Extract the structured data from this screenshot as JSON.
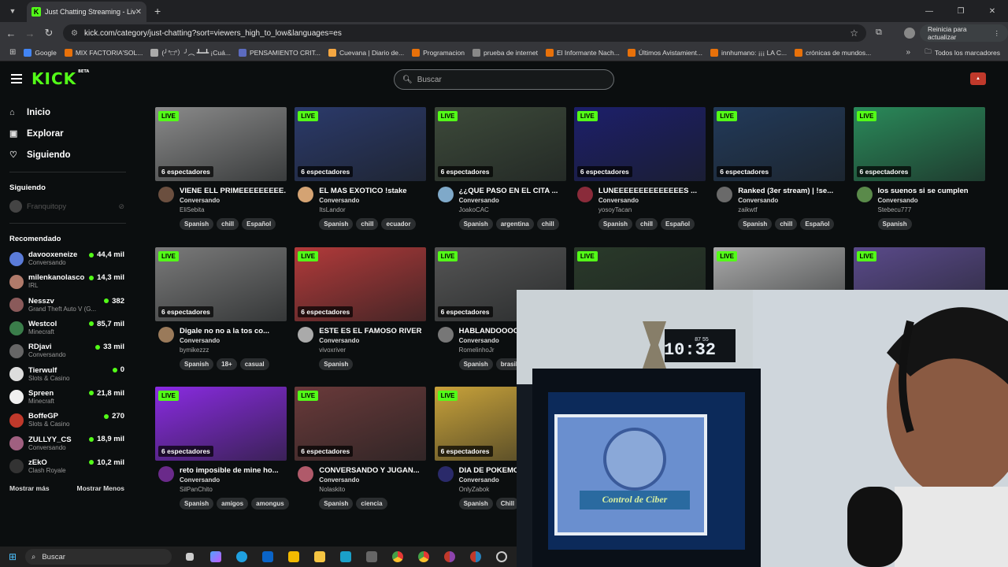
{
  "browser": {
    "tab_title": "Just Chatting Streaming - Live S",
    "url": "kick.com/category/just-chatting?sort=viewers_high_to_low&languages=es",
    "update_button": "Reinicia para actualizar",
    "bookmarks": [
      "Google",
      "MIX FACTORIA'SOL...",
      "(╯°□°）╯︵ ┻━┻ ¡Cuá...",
      "PENSAMIENTO CRIT...",
      "Cuevana | Diario de...",
      "Programacion",
      "prueba de internet",
      "El Informante Nach...",
      "Últimos Avistamient...",
      "innhumano: ¡¡¡ LA C...",
      "crónicas de mundos..."
    ],
    "all_bookmarks": "Todos los marcadores"
  },
  "header": {
    "logo": "KICK",
    "logo_badge": "BETA",
    "search_placeholder": "Buscar"
  },
  "sidebar": {
    "nav": [
      {
        "label": "Inicio",
        "icon": "home-icon"
      },
      {
        "label": "Explorar",
        "icon": "explore-icon"
      },
      {
        "label": "Siguiendo",
        "icon": "heart-icon"
      }
    ],
    "following_heading": "Siguiendo",
    "following": [
      {
        "name": "Franquitopy"
      }
    ],
    "recommended_heading": "Recomendado",
    "recommended": [
      {
        "name": "davooxeneize",
        "category": "Conversando",
        "viewers": "44,4 mil",
        "color": "#5a7bd8"
      },
      {
        "name": "milenkanolasco",
        "category": "IRL",
        "viewers": "14,3 mil",
        "color": "#b07a6a"
      },
      {
        "name": "Nesszv",
        "category": "Grand Theft Auto V (G...",
        "viewers": "382",
        "color": "#8a5a5a"
      },
      {
        "name": "Westcol",
        "category": "Minecraft",
        "viewers": "85,7 mil",
        "color": "#3a7d4a"
      },
      {
        "name": "RDjavi",
        "category": "Conversando",
        "viewers": "33 mil",
        "color": "#666"
      },
      {
        "name": "Tierwulf",
        "category": "Slots & Casino",
        "viewers": "0",
        "color": "#ddd"
      },
      {
        "name": "Spreen",
        "category": "Minecraft",
        "viewers": "21,8 mil",
        "color": "#f0f0f0"
      },
      {
        "name": "BoffeGP",
        "category": "Slots & Casino",
        "viewers": "270",
        "color": "#c0392b"
      },
      {
        "name": "ZULLYY_CS",
        "category": "Conversando",
        "viewers": "18,9 mil",
        "color": "#a06080"
      },
      {
        "name": "zEkO",
        "category": "Clash Royale",
        "viewers": "10,2 mil",
        "color": "#333"
      }
    ],
    "show_more": "Mostrar más",
    "show_less": "Mostrar Menos"
  },
  "streams": [
    {
      "title": "VIENE ELL PRIMEEEEEEEEE...",
      "category": "Conversando",
      "user": "EliSebita",
      "viewers": "6 espectadores",
      "tags": [
        "Spanish",
        "chill",
        "Español"
      ],
      "thumb": "#8a8a8a",
      "avatar": "#6b4f3f"
    },
    {
      "title": "EL MAS EXOTICO !stake",
      "category": "Conversando",
      "user": "ItsLandor",
      "viewers": "6 espectadores",
      "tags": [
        "Spanish",
        "chill",
        "ecuador"
      ],
      "thumb": "#2b3a6b",
      "avatar": "#d4a373"
    },
    {
      "title": "¿¿QUE PASO EN EL CITA ...",
      "category": "Conversando",
      "user": "JoakoCAC",
      "viewers": "6 espectadores",
      "tags": [
        "Spanish",
        "argentina",
        "chill"
      ],
      "thumb": "#3d4a3a",
      "avatar": "#7fa9c9"
    },
    {
      "title": "LUNEEEEEEEEEEEEEES ...",
      "category": "Conversando",
      "user": "yosoyTacan",
      "viewers": "6 espectadores",
      "tags": [
        "Spanish",
        "chill",
        "Español"
      ],
      "thumb": "#1c1f6b",
      "avatar": "#8a2b3a"
    },
    {
      "title": "Ranked (3er stream) | !se...",
      "category": "Conversando",
      "user": "zaikwtf",
      "viewers": "6 espectadores",
      "tags": [
        "Spanish",
        "chill",
        "Español"
      ],
      "thumb": "#223a5a",
      "avatar": "#6a6a6a"
    },
    {
      "title": "los suenos si se cumplen",
      "category": "Conversando",
      "user": "Stebecu777",
      "viewers": "6 espectadores",
      "tags": [
        "Spanish"
      ],
      "thumb": "#2a8a5a",
      "avatar": "#5a8a4a"
    },
    {
      "title": "Digale no no a la tos co...",
      "category": "Conversando",
      "user": "bymikezzz",
      "viewers": "6 espectadores",
      "tags": [
        "Spanish",
        "18+",
        "casual"
      ],
      "thumb": "#7a7a7a",
      "avatar": "#9a7a5a"
    },
    {
      "title": "ESTE ES EL FAMOSO RIVER",
      "category": "Conversando",
      "user": "vivoxriver",
      "viewers": "6 espectadores",
      "tags": [
        "Spanish"
      ],
      "thumb": "#b23a3a",
      "avatar": "#aaa"
    },
    {
      "title": "HABLANDOOOOO",
      "category": "Conversando",
      "user": "RomelinhoJr",
      "viewers": "6 espectadores",
      "tags": [
        "Spanish",
        "brasil"
      ],
      "thumb": "#555",
      "avatar": "#777"
    },
    {
      "title": "",
      "category": "",
      "user": "",
      "viewers": "",
      "tags": [],
      "thumb": "#2a3a2a",
      "avatar": "#444"
    },
    {
      "title": "",
      "category": "",
      "user": "",
      "viewers": "",
      "tags": [],
      "thumb": "#aaa",
      "avatar": "#444"
    },
    {
      "title": "",
      "category": "",
      "user": "",
      "viewers": "",
      "tags": [],
      "thumb": "#5a4a8a",
      "avatar": "#444"
    },
    {
      "title": "reto imposible de mine ho...",
      "category": "Conversando",
      "user": "SilPanChito",
      "viewers": "6 espectadores",
      "tags": [
        "Spanish",
        "amigos",
        "amongus"
      ],
      "thumb": "#8a2be2",
      "avatar": "#6a2a8a"
    },
    {
      "title": "CONVERSANDO Y JUGAN...",
      "category": "Conversando",
      "user": "Nolaskito",
      "viewers": "6 espectadores",
      "tags": [
        "Spanish",
        "ciencia"
      ],
      "thumb": "#6a3a3a",
      "avatar": "#b05a6a"
    },
    {
      "title": "DIA DE POKEMO",
      "category": "Conversando",
      "user": "OnlyZabok",
      "viewers": "6 espectadores",
      "tags": [
        "Spanish",
        "Chill"
      ],
      "thumb": "#c8a23a",
      "avatar": "#2a2a6a"
    },
    {
      "title": "",
      "category": "",
      "user": "",
      "viewers": "",
      "tags": [],
      "thumb": "#333",
      "avatar": "#444"
    },
    {
      "title": "",
      "category": "",
      "user": "",
      "viewers": "",
      "tags": [],
      "thumb": "#333",
      "avatar": "#444"
    },
    {
      "title": "",
      "category": "",
      "user": "",
      "viewers": "",
      "tags": [],
      "thumb": "#333",
      "avatar": "#444"
    }
  ],
  "live_label": "LIVE",
  "webcam": {
    "clock": "10:32",
    "clock_small": "87 55",
    "sign": "Control de Ciber"
  },
  "taskbar": {
    "search": "Buscar"
  },
  "colors": {
    "accent": "#53fc18",
    "background": "#0b0e0f"
  }
}
